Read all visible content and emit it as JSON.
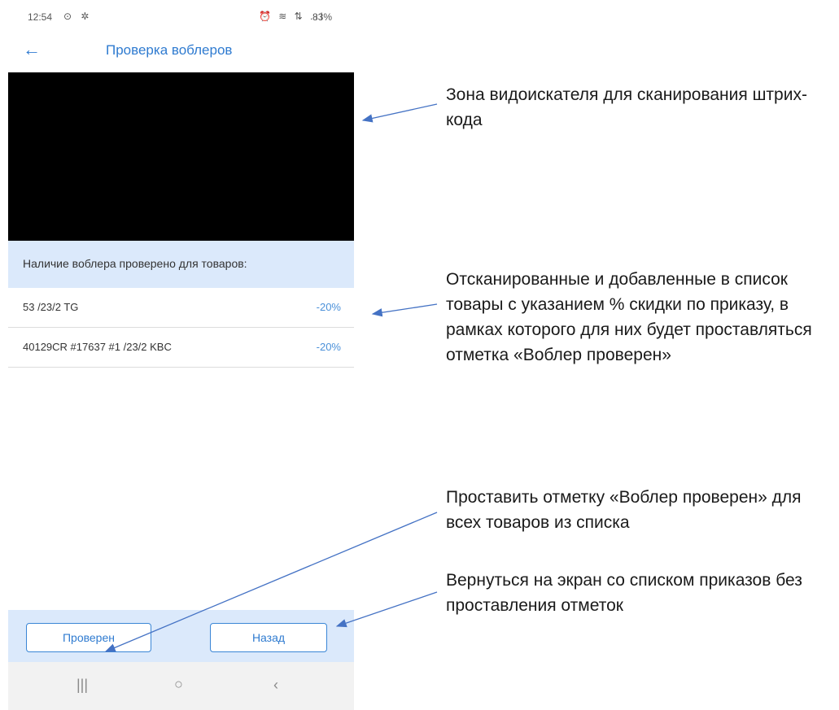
{
  "status_bar": {
    "time": "12:54",
    "left_icons": "⊙ ✲",
    "right_icons": "⏰ ≋ ⇅ .ıl",
    "battery": "83%"
  },
  "app_bar": {
    "back_icon": "←",
    "title": "Проверка воблеров"
  },
  "list": {
    "header": "Наличие воблера проверено для товаров:",
    "items": [
      {
        "code": "53 /23/2 TG",
        "discount": "-20%"
      },
      {
        "code": "40129CR #17637 #1 /23/2 KBC",
        "discount": "-20%"
      }
    ]
  },
  "buttons": {
    "checked": "Проверен",
    "back": "Назад"
  },
  "nav": {
    "recent": "|||",
    "home": "○",
    "back": "‹"
  },
  "annotations": {
    "viewfinder": "Зона видоискателя для сканирования штрих-кода",
    "list": "Отсканированные и добавленные в список товары с указанием % скидки по приказу, в рамках которого для них будет проставляться отметка «Воблер проверен»",
    "checked_button": "Проставить отметку «Воблер проверен» для всех товаров из списка",
    "back_button": "Вернуться на экран со списком приказов без проставления отметок"
  },
  "colors": {
    "accent": "#2f7bd0",
    "panel": "#dbe9fb",
    "arrow": "#4472c4"
  }
}
